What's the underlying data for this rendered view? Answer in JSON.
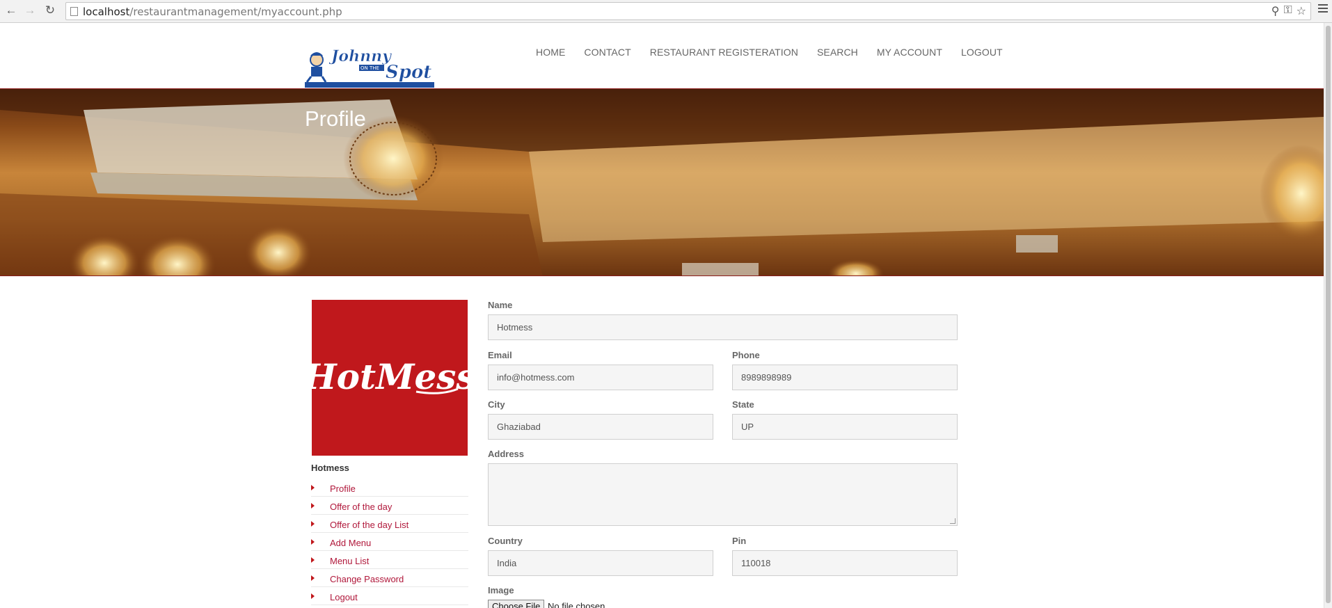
{
  "browser": {
    "url_host": "localhost",
    "url_path": "/restaurantmanagement/myaccount.php"
  },
  "site": {
    "logo_text_top": "Johnny",
    "logo_text_mid": "ON THE",
    "logo_text_bottom": "Spot",
    "nav": [
      "HOME",
      "CONTACT",
      "RESTAURANT REGISTERATION",
      "SEARCH",
      "MY ACCOUNT",
      "LOGOUT"
    ]
  },
  "hero": {
    "title": "Profile"
  },
  "sidebar": {
    "image_text": "HotMess",
    "name": "Hotmess",
    "menu": [
      "Profile",
      "Offer of the day",
      "Offer of the day List",
      "Add Menu",
      "Menu List",
      "Change Password",
      "Logout"
    ]
  },
  "form": {
    "name_label": "Name",
    "name_value": "Hotmess",
    "email_label": "Email",
    "email_value": "info@hotmess.com",
    "phone_label": "Phone",
    "phone_value": "8989898989",
    "city_label": "City",
    "city_value": "Ghaziabad",
    "state_label": "State",
    "state_value": "UP",
    "address_label": "Address",
    "address_value": "",
    "country_label": "Country",
    "country_value": "India",
    "pin_label": "Pin",
    "pin_value": "110018",
    "image_label": "Image",
    "file_button": "Choose File",
    "file_status": "No file chosen"
  },
  "colors": {
    "accent": "#c0181c",
    "link": "#b0173a"
  }
}
